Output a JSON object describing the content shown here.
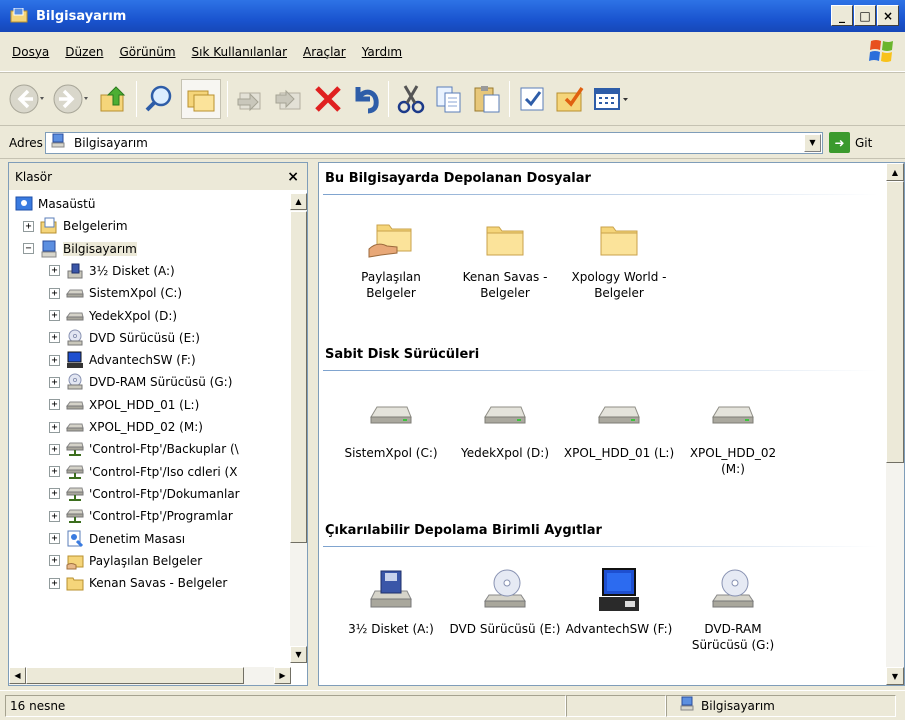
{
  "window": {
    "title": "Bilgisayarım",
    "controls": [
      "_",
      "□",
      "×"
    ]
  },
  "menu": [
    "Dosya",
    "Düzen",
    "Görünüm",
    "Sık Kullanılanlar",
    "Araçlar",
    "Yardım"
  ],
  "address": {
    "label": "Adres",
    "value": "Bilgisayarım",
    "go_label": "Git"
  },
  "folders_pane": {
    "title": "Klasör",
    "close": "×",
    "tree": [
      {
        "label": "Masaüstü",
        "icon": "desktop-icon"
      },
      {
        "label": "Belgelerim",
        "icon": "documents-icon"
      },
      {
        "label": "Bilgisayarım",
        "icon": "computer-icon"
      },
      {
        "label": "3½ Disket (A:)",
        "icon": "floppy-icon"
      },
      {
        "label": "SistemXpol (C:)",
        "icon": "hard-disk-icon"
      },
      {
        "label": "YedekXpol (D:)",
        "icon": "hard-disk-icon"
      },
      {
        "label": "DVD Sürücüsü (E:)",
        "icon": "dvd-drive-icon"
      },
      {
        "label": "AdvantechSW (F:)",
        "icon": "network-computer-icon"
      },
      {
        "label": "DVD-RAM Sürücüsü (G:)",
        "icon": "dvd-drive-icon"
      },
      {
        "label": "XPOL_HDD_01 (L:)",
        "icon": "hard-disk-icon"
      },
      {
        "label": "XPOL_HDD_02 (M:)",
        "icon": "hard-disk-icon"
      },
      {
        "label": "'Control-Ftp'/Backuplar (\\",
        "icon": "network-drive-icon"
      },
      {
        "label": "'Control-Ftp'/Iso cdleri (X",
        "icon": "network-drive-icon"
      },
      {
        "label": "'Control-Ftp'/Dokumanlar",
        "icon": "network-drive-icon"
      },
      {
        "label": "'Control-Ftp'/Programlar",
        "icon": "network-drive-icon"
      },
      {
        "label": "Denetim Masası",
        "icon": "control-panel-icon"
      },
      {
        "label": "Paylaşılan Belgeler",
        "icon": "shared-folder-icon"
      },
      {
        "label": "Kenan Savas - Belgeler",
        "icon": "folder-icon"
      }
    ]
  },
  "groups": [
    {
      "title": "Bu Bilgisayarda Depolanan Dosyalar",
      "items": [
        {
          "label": "Paylaşılan Belgeler",
          "icon": "shared-folder-icon"
        },
        {
          "label": "Kenan Savas - Belgeler",
          "icon": "folder-icon"
        },
        {
          "label": "Xpology World - Belgeler",
          "icon": "folder-icon"
        }
      ]
    },
    {
      "title": "Sabit Disk Sürücüleri",
      "items": [
        {
          "label": "SistemXpol (C:)",
          "icon": "hard-disk-icon"
        },
        {
          "label": "YedekXpol (D:)",
          "icon": "hard-disk-icon"
        },
        {
          "label": "XPOL_HDD_01 (L:)",
          "icon": "hard-disk-icon"
        },
        {
          "label": "XPOL_HDD_02 (M:)",
          "icon": "hard-disk-icon"
        }
      ]
    },
    {
      "title": "Çıkarılabilir Depolama Birimli Aygıtlar",
      "items": [
        {
          "label": "3½ Disket (A:)",
          "icon": "floppy-icon"
        },
        {
          "label": "DVD Sürücüsü (E:)",
          "icon": "dvd-drive-icon"
        },
        {
          "label": "AdvantechSW (F:)",
          "icon": "network-computer-icon"
        },
        {
          "label": "DVD-RAM Sürücüsü (G:)",
          "icon": "dvd-drive-icon"
        }
      ]
    }
  ],
  "status": {
    "count": "16 nesne",
    "location": "Bilgisayarım"
  },
  "colors": {
    "titlebar": "#1A55D0",
    "chrome": "#ECE9D8",
    "folder": "#F5D57A",
    "group_line": "#7DA2CE"
  }
}
